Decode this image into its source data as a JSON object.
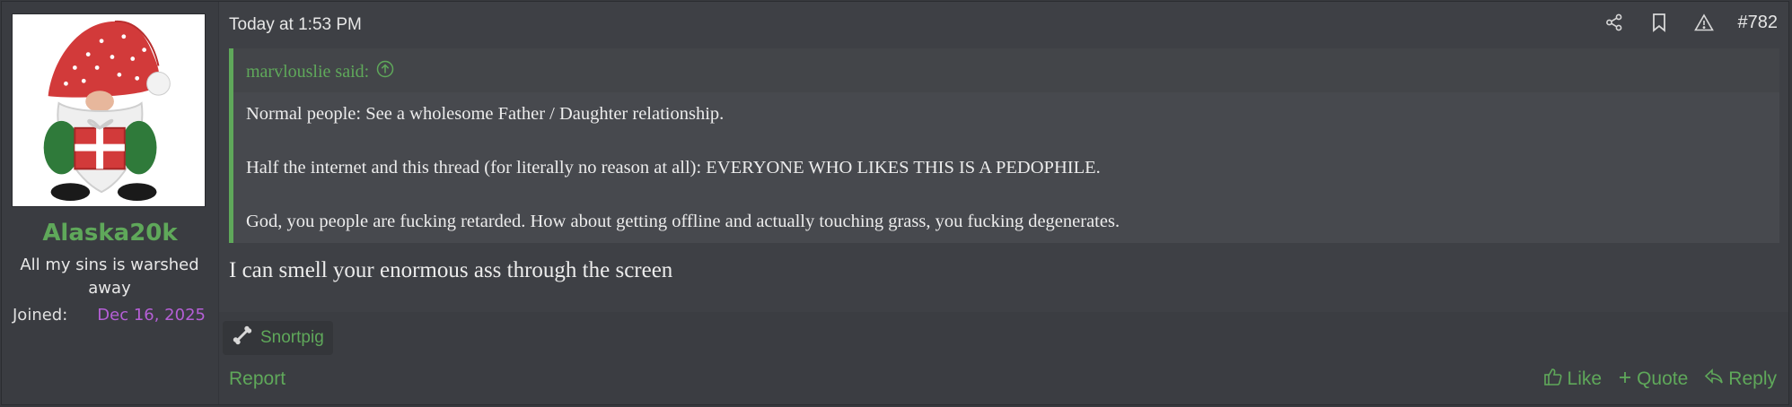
{
  "user": {
    "name": "Alaska20k",
    "title": "All my sins is warshed away",
    "joined_label": "Joined:",
    "joined_value": "Dec 16, 2025",
    "avatar_icon": "gnome-avatar",
    "name_color": "#5fa85a",
    "joined_color": "#b55fd6"
  },
  "post": {
    "date": "Today at 1:53 PM",
    "number": "#782",
    "icons": [
      "share-icon",
      "bookmark-icon",
      "report-warning-icon"
    ],
    "quote": {
      "author": "marvlouslie said:",
      "lines": [
        "Normal people: See a wholesome Father / Daughter relationship.",
        "Half the internet and this thread (for literally no reason at all): EVERYONE WHO LIKES THIS IS A PEDOPHILE.",
        "God, you people are fucking retarded. How about getting offline and actually touching grass, you fucking degenerates."
      ]
    },
    "message": "I can smell your enormous ass through the screen"
  },
  "footer": {
    "reaction_user": "Snortpig",
    "report_label": "Report",
    "like_label": "Like",
    "quote_label": "Quote",
    "reply_label": "Reply",
    "accent_color": "#5fa85a"
  }
}
